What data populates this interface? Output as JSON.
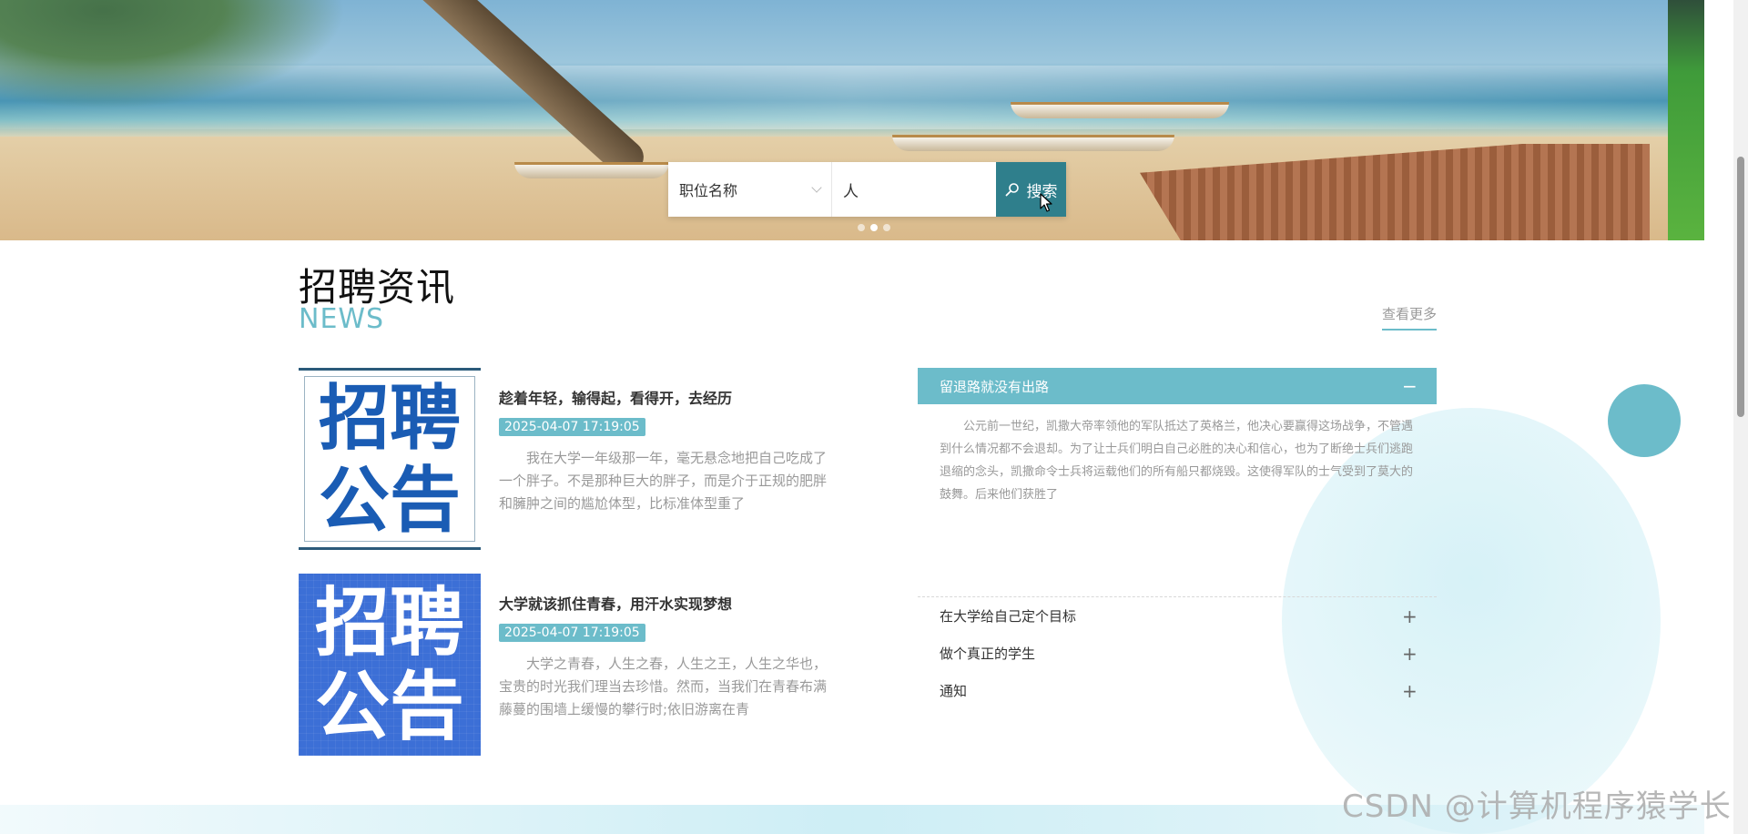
{
  "search": {
    "select_value": "职位名称",
    "input_value": "人",
    "button_label": "搜索"
  },
  "news_section": {
    "title": "招聘资讯",
    "subtitle": "NEWS",
    "more_label": "查看更多"
  },
  "news_items": [
    {
      "thumb_lines": [
        "招聘",
        "公告"
      ],
      "title": "趁着年轻，输得起，看得开，去经历",
      "date": "2025-04-07 17:19:05",
      "excerpt": "我在大学一年级那一年，毫无悬念地把自己吃成了一个胖子。不是那种巨大的胖子，而是介于正规的肥胖和臃肿之间的尴尬体型，比标准体型重了"
    },
    {
      "thumb_lines": [
        "招聘",
        "公告"
      ],
      "title": "大学就该抓住青春，用汗水实现梦想",
      "date": "2025-04-07 17:19:05",
      "excerpt": "大学之青春，人生之春，人生之王，人生之华也，宝贵的时光我们理当去珍惜。然而，当我们在青春布满藤蔓的围墙上缓慢的攀行时;依旧游离在青"
    }
  ],
  "accordion": {
    "open": {
      "title": "留退路就没有出路",
      "sign": "−",
      "content": "公元前一世纪，凯撒大帝率领他的军队抵达了英格兰，他决心要赢得这场战争，不管遇到什么情况都不会退却。为了让士兵们明白自己必胜的决心和信心，也为了断绝士兵们逃跑退缩的念头，凯撒命令士兵将运载他们的所有船只都烧毁。这使得军队的士气受到了莫大的鼓舞。后来他们获胜了"
    },
    "items": [
      {
        "title": "在大学给自己定个目标",
        "sign": "+"
      },
      {
        "title": "做个真正的学生",
        "sign": "+"
      },
      {
        "title": "通知",
        "sign": "+"
      }
    ]
  },
  "watermark": "CSDN @计算机程序猿学长",
  "colors": {
    "accent": "#6cbcca",
    "search_button": "#2f7f8c",
    "date_badge": "#6cbcca"
  }
}
